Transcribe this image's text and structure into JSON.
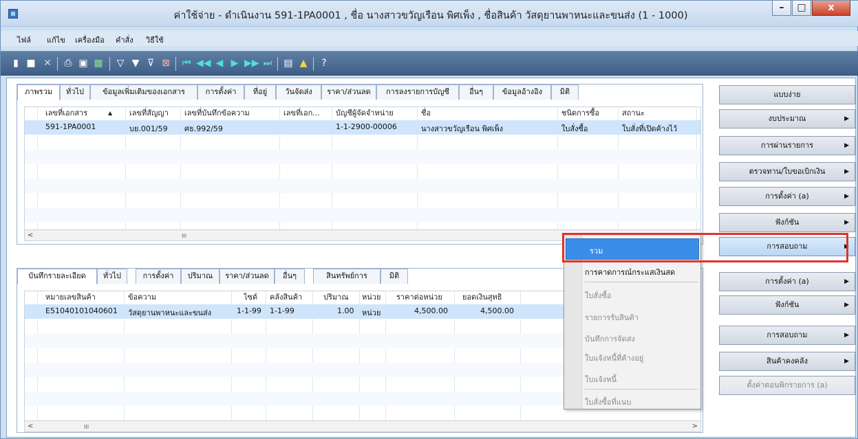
{
  "window": {
    "title": "ค่าใช้จ่าย - ดำเนินงาน 591-1PA0001 , ชื่อ นางสาวขวัญเรือน พิศเพ็ง , ชื่อสินค้า วัสดุยานพาหนะและขนส่ง (1 - 1000)",
    "min_label": "–",
    "max_label": "□",
    "close_label": "x"
  },
  "menu": [
    "ไฟล์",
    "แก้ไข",
    "เครื่องมือ",
    "คำสั่ง",
    "วิธีใช้"
  ],
  "toolbar_icons": [
    "new-icon",
    "save-icon",
    "delete-icon",
    "print-icon",
    "print-preview-icon",
    "excel-icon",
    "filter-icon",
    "filter-by-selection-icon",
    "advanced-filter-icon",
    "remove-filter-icon",
    "first-record-icon",
    "previous-page-icon",
    "previous-record-icon",
    "next-record-icon",
    "next-page-icon",
    "last-record-icon",
    "document-handling-icon",
    "alert-icon",
    "help-icon"
  ],
  "header_tabs": [
    "ภาพรวม",
    "ทั่วไป",
    "ข้อมูลเพิ่มเติมของเอกสาร",
    "การตั้งค่า",
    "ที่อยู่",
    "วันจัดส่ง",
    "ราคา/ส่วนลด",
    "การลงรายการบัญชี",
    "อื่นๆ",
    "ข้อมูลอ้างอิง",
    "มิติ"
  ],
  "header_grid": {
    "columns": [
      "เลขที่เอกสาร",
      "เลขที่สัญญา",
      "เลขที่บันทึกข้อความ",
      "เลขที่เอก...",
      "บัญชีผู้จัดจำหน่าย",
      "ชื่อ",
      "ชนิดการซื้อ",
      "สถานะ"
    ],
    "sort_indicator": "▲",
    "rows": [
      [
        "591-1PA0001",
        "บย.001/59",
        "ศธ.992/59",
        "",
        "1-1-2900-00006",
        "นางสาวขวัญเรือน พิศเพ็ง",
        "ใบสั่งซื้อ",
        "ใบสั่งที่เปิดค้างไว้"
      ]
    ]
  },
  "line_tabs": [
    "บันทึกรายละเอียด",
    "ทั่วไป",
    "การตั้งค่า",
    "ปริมาณ",
    "ราคา/ส่วนลด",
    "อื่นๆ",
    "สินทรัพย์การ",
    "มิติ"
  ],
  "line_grid": {
    "columns": [
      "หมายเลขสินค้า",
      "ข้อความ",
      "ไซต์",
      "คลังสินค้า",
      "ปริมาณ",
      "หน่วย",
      "ราคาต่อหน่วย",
      "ยอดเงินสุทธิ"
    ],
    "rows": [
      [
        "E51040101040601",
        "วัสดุยานพาหนะและขนส่ง",
        "1-1-99",
        "1-1-99",
        "1.00",
        "หน่วย",
        "4,500.00",
        "4,500.00"
      ]
    ]
  },
  "scroll_thumb": "III",
  "right_buttons_top": [
    {
      "label": "แบบง่าย",
      "arrow": ""
    },
    {
      "label": "งบประมาณ",
      "arrow": "▶"
    },
    {
      "label": "การผ่านรายการ",
      "arrow": "▶"
    },
    {
      "label": "ตรวจทาน/ใบขอเบิกเงิน",
      "arrow": "▶"
    },
    {
      "label": "การตั้งค่า (a)",
      "arrow": "▶"
    },
    {
      "label": "ฟังก์ชัน",
      "arrow": "▶"
    },
    {
      "label": "การสอบถาม",
      "arrow": "▶"
    }
  ],
  "right_buttons_bottom": [
    {
      "label": "การตั้งค่า (a)",
      "arrow": "▶"
    },
    {
      "label": "ฟังก์ชัน",
      "arrow": "▶"
    },
    {
      "label": "การสอบถาม",
      "arrow": "▶"
    },
    {
      "label": "สินค้าคงคลัง",
      "arrow": "▶"
    },
    {
      "label": "ตั้งค่าตอนพิกรายการ (a)",
      "arrow": ""
    }
  ],
  "context_menu": {
    "selected": "รวม",
    "items": [
      "การคาดการณ์กระแสเงินสด",
      "ใบสั่งซื้อ",
      "รายการรับสินค้า",
      "บันทึกการจัดส่ง",
      "ใบแจ้งหนี้ที่ค้างอยู่",
      "ใบแจ้งหนี้",
      "ใบสั่งซื้อที่แนบ"
    ]
  },
  "colors": {
    "selection": "#3a8ee8",
    "highlight_box": "#e2322a",
    "row_selected": "#cfe5fb"
  }
}
